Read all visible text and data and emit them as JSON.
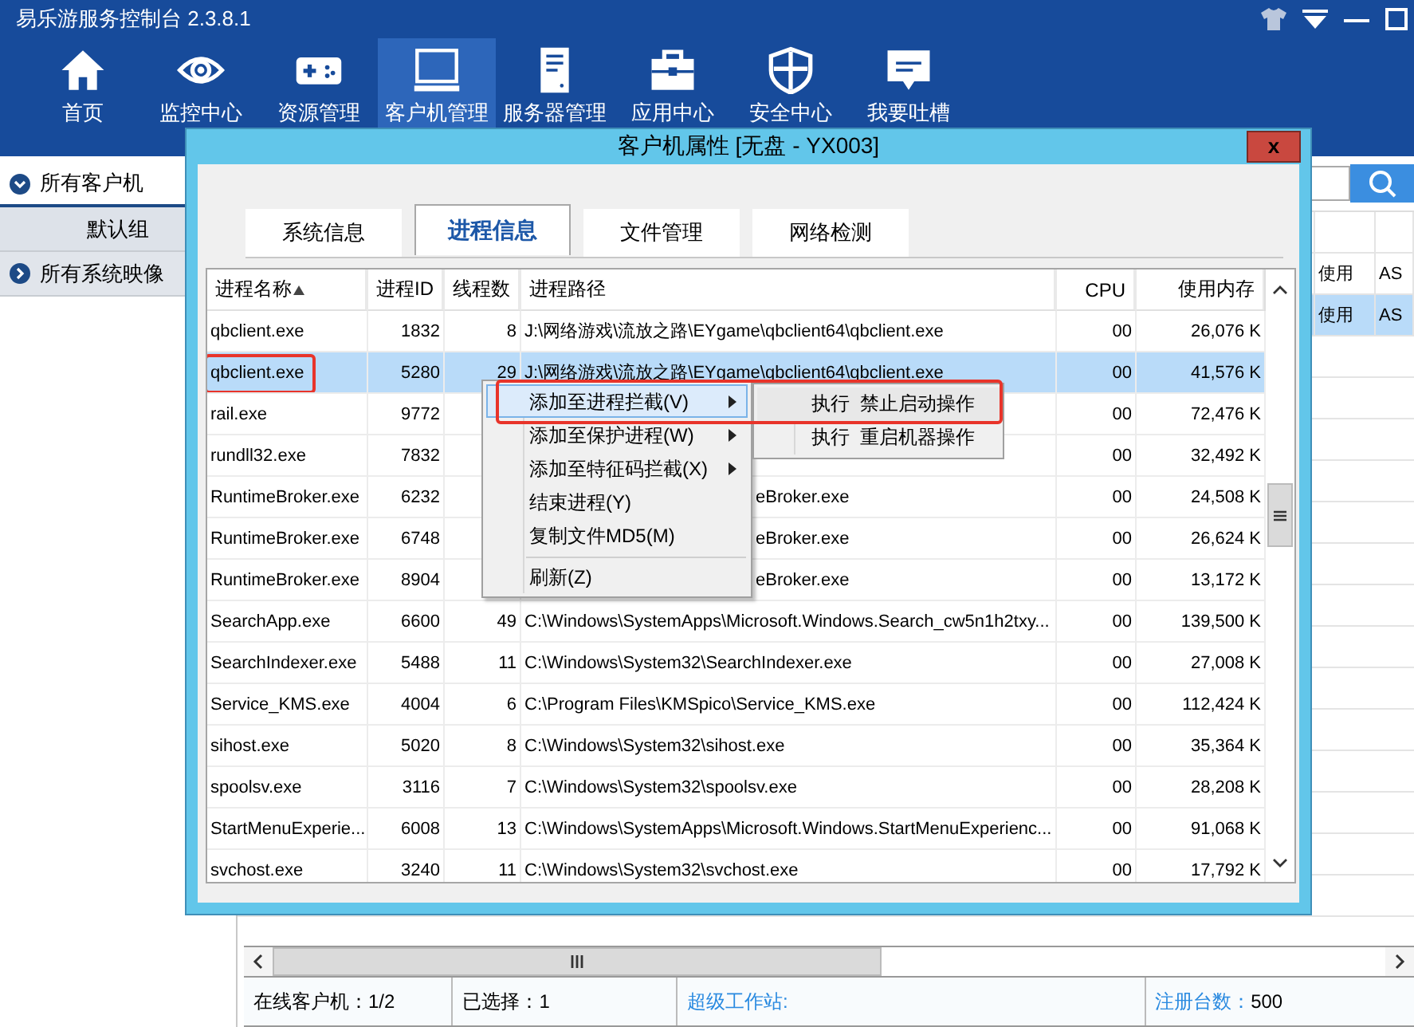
{
  "app": {
    "title": "易乐游服务控制台 2.3.8.1"
  },
  "nav": [
    {
      "label": "首页",
      "selected": false
    },
    {
      "label": "监控中心",
      "selected": false
    },
    {
      "label": "资源管理",
      "selected": false
    },
    {
      "label": "客户机管理",
      "selected": true
    },
    {
      "label": "服务器管理",
      "selected": false
    },
    {
      "label": "应用中心",
      "selected": false
    },
    {
      "label": "安全中心",
      "selected": false
    },
    {
      "label": "我要吐槽",
      "selected": false
    }
  ],
  "sidebar": {
    "groups": [
      {
        "label": "所有客户机",
        "expanded": true,
        "children": [
          {
            "label": "默认组",
            "selected": true
          }
        ]
      },
      {
        "label": "所有系统映像",
        "expanded": false
      }
    ]
  },
  "main_table": {
    "rows": [
      {
        "cells": [
          "使用",
          "AS"
        ],
        "selected": false
      },
      {
        "cells": [
          "使用",
          "AS"
        ],
        "selected": true
      }
    ]
  },
  "status_bar": [
    {
      "label": "在线客户机：",
      "value": "1/2",
      "kind": "plain"
    },
    {
      "label": "已选择：",
      "value": "1",
      "kind": "plain"
    },
    {
      "label": "超级工作站:",
      "kind": "link"
    },
    {
      "label": "注册台数：",
      "value": "500",
      "kind": "link"
    }
  ],
  "dialog": {
    "title": "客户机属性 [无盘 - YX003]",
    "close": "x",
    "tabs": [
      {
        "label": "系统信息",
        "selected": false
      },
      {
        "label": "进程信息",
        "selected": true
      },
      {
        "label": "文件管理",
        "selected": false
      },
      {
        "label": "网络检测",
        "selected": false
      }
    ],
    "columns": [
      {
        "label": "进程名称",
        "sorted": true
      },
      {
        "label": "进程ID",
        "sorted": false
      },
      {
        "label": "线程数",
        "sorted": false
      },
      {
        "label": "进程路径",
        "sorted": false
      },
      {
        "label": "CPU",
        "sorted": false
      },
      {
        "label": "使用内存",
        "sorted": false
      }
    ],
    "rows": [
      {
        "name": "qbclient.exe",
        "pid": "1832",
        "threads": "8",
        "path": "J:\\网络游戏\\流放之路\\EYgame\\qbclient64\\qbclient.exe",
        "cpu": "00",
        "memory": "26,076 K",
        "selected": false,
        "marked": false
      },
      {
        "name": "qbclient.exe",
        "pid": "5280",
        "threads": "29",
        "path": "J:\\网络游戏\\流放之路\\EYgame\\qbclient64\\qbclient.exe",
        "cpu": "00",
        "memory": "41,576 K",
        "selected": true,
        "marked": true
      },
      {
        "name": "rail.exe",
        "pid": "9772",
        "cpu": "00",
        "memory": "72,476 K",
        "selected": false,
        "marked": false
      },
      {
        "name": "rundll32.exe",
        "pid": "7832",
        "cpu": "00",
        "memory": "32,492 K",
        "selected": false,
        "marked": false
      },
      {
        "name": "RuntimeBroker.exe",
        "pid": "6232",
        "path": "eBroker.exe",
        "cpu": "00",
        "memory": "24,508 K",
        "selected": false,
        "marked": false
      },
      {
        "name": "RuntimeBroker.exe",
        "pid": "6748",
        "path": "eBroker.exe",
        "cpu": "00",
        "memory": "26,624 K",
        "selected": false,
        "marked": false
      },
      {
        "name": "RuntimeBroker.exe",
        "pid": "8904",
        "path": "eBroker.exe",
        "cpu": "00",
        "memory": "13,172 K",
        "selected": false,
        "marked": false
      },
      {
        "name": "SearchApp.exe",
        "pid": "6600",
        "threads": "49",
        "path": "C:\\Windows\\SystemApps\\Microsoft.Windows.Search_cw5n1h2txy...",
        "cpu": "00",
        "memory": "139,500 K",
        "selected": false,
        "marked": false
      },
      {
        "name": "SearchIndexer.exe",
        "pid": "5488",
        "threads": "11",
        "path": "C:\\Windows\\System32\\SearchIndexer.exe",
        "cpu": "00",
        "memory": "27,008 K",
        "selected": false,
        "marked": false
      },
      {
        "name": "Service_KMS.exe",
        "pid": "4004",
        "threads": "6",
        "path": "C:\\Program Files\\KMSpico\\Service_KMS.exe",
        "cpu": "00",
        "memory": "112,424 K",
        "selected": false,
        "marked": false
      },
      {
        "name": "sihost.exe",
        "pid": "5020",
        "threads": "8",
        "path": "C:\\Windows\\System32\\sihost.exe",
        "cpu": "00",
        "memory": "35,364 K",
        "selected": false,
        "marked": false
      },
      {
        "name": "spoolsv.exe",
        "pid": "3116",
        "threads": "7",
        "path": "C:\\Windows\\System32\\spoolsv.exe",
        "cpu": "00",
        "memory": "28,208 K",
        "selected": false,
        "marked": false
      },
      {
        "name": "StartMenuExperie...",
        "pid": "6008",
        "threads": "13",
        "path": "C:\\Windows\\SystemApps\\Microsoft.Windows.StartMenuExperienc...",
        "cpu": "00",
        "memory": "91,068 K",
        "selected": false,
        "marked": false
      },
      {
        "name": "svchost.exe",
        "pid": "3240",
        "threads": "11",
        "path": "C:\\Windows\\System32\\svchost.exe",
        "cpu": "00",
        "memory": "17,792 K",
        "selected": false,
        "marked": false
      }
    ],
    "context_menu": {
      "marked": true,
      "items": [
        {
          "label": "添加至进程拦截(V)",
          "submenu": true,
          "highlighted": true,
          "separator_before": false
        },
        {
          "label": "添加至保护进程(W)",
          "submenu": true,
          "highlighted": false,
          "separator_before": false
        },
        {
          "label": "添加至特征码拦截(X)",
          "submenu": true,
          "highlighted": false,
          "separator_before": false
        },
        {
          "label": "结束进程(Y)",
          "submenu": false,
          "highlighted": false,
          "separator_before": false
        },
        {
          "label": "复制文件MD5(M)",
          "submenu": false,
          "highlighted": false,
          "separator_before": false
        },
        {
          "label": "刷新(Z)",
          "submenu": false,
          "highlighted": false,
          "separator_before": true
        }
      ],
      "submenu": [
        {
          "label": "执行  禁止启动操作",
          "highlighted": true
        },
        {
          "label": "执行  重启机器操作",
          "highlighted": false
        }
      ]
    }
  }
}
